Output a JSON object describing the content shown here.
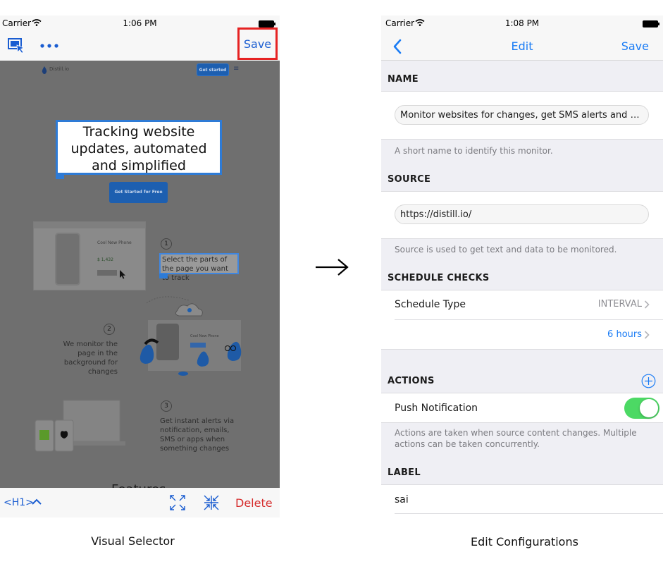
{
  "left": {
    "status": {
      "carrier": "Carrier",
      "time": "1:06 PM"
    },
    "toolbar_top": {
      "save_label": "Save"
    },
    "webpage": {
      "brand": "Distill.io",
      "get_started": "Get started",
      "headline": "Tracking website updates, automated and simplified",
      "cta": "Get Started for Free",
      "mock_title": "Cool New Phone",
      "mock_price": "$ 1,432",
      "step1_num": "1",
      "step1_text": "Select the parts of the page you want to track",
      "step2_num": "2",
      "step2_text": "We monitor the page in the background for changes",
      "step3_num": "3",
      "step3_text": "Get instant alerts via notification, emails, SMS or apps when something changes",
      "features": "Features"
    },
    "toolbar_bottom": {
      "tag_label": "<H1>",
      "delete_label": "Delete"
    },
    "caption": "Visual Selector"
  },
  "right": {
    "status": {
      "carrier": "Carrier",
      "time": "1:08 PM"
    },
    "nav": {
      "title": "Edit",
      "save_label": "Save"
    },
    "name": {
      "header": "NAME",
      "value": "Monitor websites for changes, get SMS alerts and em...",
      "hint": "A short name to identify this monitor."
    },
    "source": {
      "header": "SOURCE",
      "value": "https://distill.io/",
      "hint": "Source is used to get text and data to be monitored."
    },
    "schedule": {
      "header": "SCHEDULE CHECKS",
      "type_label": "Schedule Type",
      "type_value": "INTERVAL",
      "interval_value": "6 hours"
    },
    "actions": {
      "header": "ACTIONS",
      "push_label": "Push Notification",
      "push_enabled": true,
      "hint_line1": "Actions are taken when source content changes. Multiple",
      "hint_line2": "actions can be taken concurrently."
    },
    "label": {
      "header": "LABEL",
      "value": "sai"
    },
    "caption": "Edit Configurations"
  },
  "colors": {
    "ios_blue": "#1a7cf5",
    "delete_red": "#d62c2c",
    "highlight_red": "#e62222",
    "toggle_green": "#4cd964"
  }
}
